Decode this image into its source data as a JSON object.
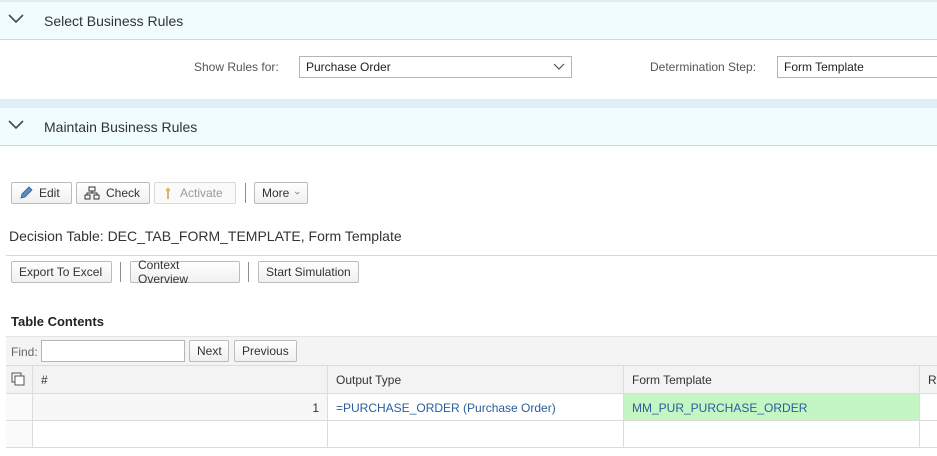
{
  "sections": {
    "select": {
      "title": "Select Business Rules"
    },
    "maintain": {
      "title": "Maintain Business Rules"
    }
  },
  "filters": {
    "show_rules_label": "Show Rules for:",
    "show_rules_value": "Purchase Order",
    "determination_label": "Determination Step:",
    "determination_value": "Form Template"
  },
  "toolbar": {
    "edit": "Edit",
    "check": "Check",
    "activate": "Activate",
    "more": "More"
  },
  "decision_table": {
    "title": "Decision Table: DEC_TAB_FORM_TEMPLATE, Form Template"
  },
  "actions": {
    "export": "Export To Excel",
    "context": "Context Overview",
    "simulation": "Start Simulation"
  },
  "table_contents": {
    "title": "Table Contents",
    "find_label": "Find:",
    "find_value": "",
    "next": "Next",
    "previous": "Previous",
    "columns": [
      "#",
      "Output Type",
      "Form Template",
      "R"
    ],
    "rows": [
      {
        "num": "1",
        "output_type": "=PURCHASE_ORDER (Purchase Order)",
        "form_template": "MM_PUR_PURCHASE_ORDER"
      },
      {
        "num": "",
        "output_type": "",
        "form_template": ""
      }
    ]
  },
  "colors": {
    "highlight": "#c3f6c3",
    "link": "#2a5e9b",
    "header_band": "#f1fcfe"
  }
}
